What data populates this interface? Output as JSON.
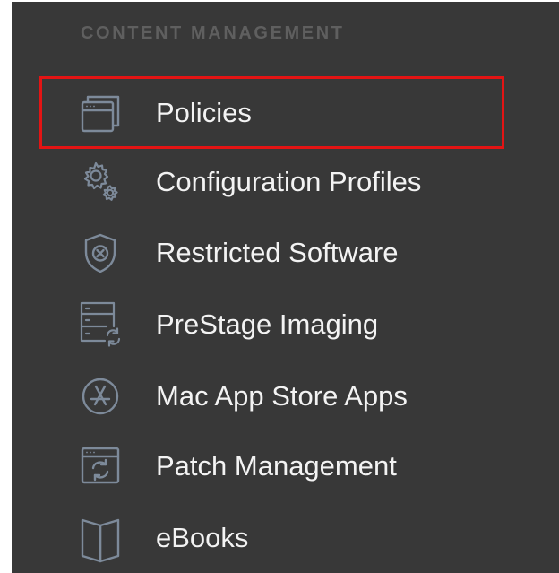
{
  "sidebar": {
    "section_title": "CONTENT MANAGEMENT",
    "items": [
      {
        "label": "Policies",
        "icon": "policies-window-stack-icon",
        "active": true
      },
      {
        "label": "Configuration Profiles",
        "icon": "gears-icon",
        "active": false
      },
      {
        "label": "Restricted Software",
        "icon": "shield-x-icon",
        "active": false
      },
      {
        "label": "PreStage Imaging",
        "icon": "server-sync-icon",
        "active": false
      },
      {
        "label": "Mac App Store Apps",
        "icon": "app-store-icon",
        "active": false
      },
      {
        "label": "Patch Management",
        "icon": "window-sync-icon",
        "active": false
      },
      {
        "label": "eBooks",
        "icon": "book-icon",
        "active": false
      }
    ]
  },
  "colors": {
    "panel_bg": "#383838",
    "section_title": "#5f5f5f",
    "label": "#f3f3f3",
    "icon_stroke": "#7d8a9a",
    "highlight": "#e31414"
  }
}
